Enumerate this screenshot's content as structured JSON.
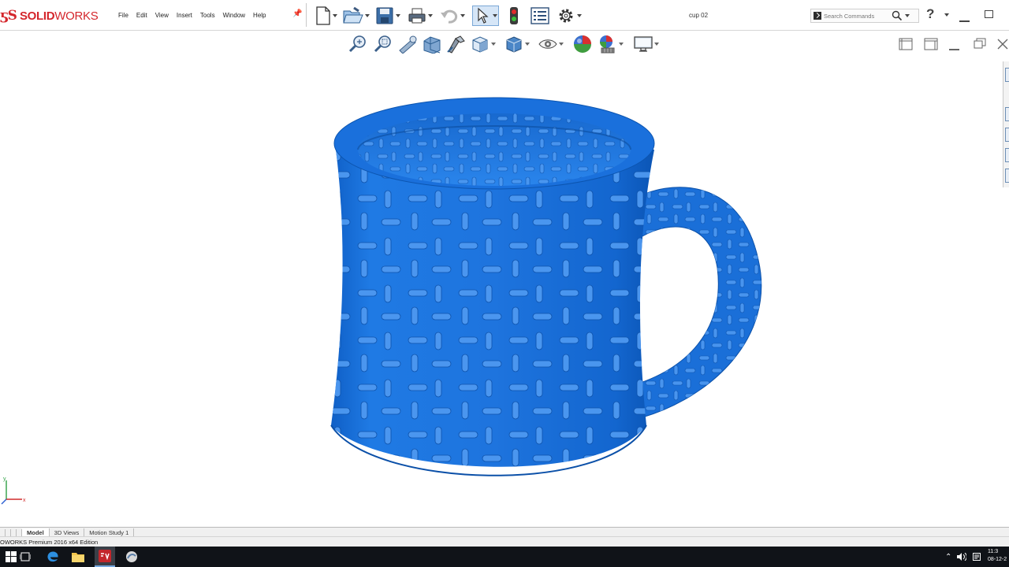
{
  "app": {
    "logo_mark": "ƽS",
    "logo_text_bold": "SOLID",
    "logo_text_light": "WORKS",
    "document_title": "cup 02",
    "brand_color": "#d4262c"
  },
  "menu": {
    "items": [
      "File",
      "Edit",
      "View",
      "Insert",
      "Tools",
      "Window",
      "Help"
    ]
  },
  "icons": {
    "main_toolbar": [
      "new-document-icon",
      "open-icon",
      "save-icon",
      "print-icon",
      "undo-icon",
      "select-icon",
      "rebuild-icon",
      "file-properties-icon",
      "options-icon"
    ],
    "view_toolbar": [
      "zoom-to-fit-icon",
      "zoom-to-area-icon",
      "previous-view-icon",
      "section-view-icon",
      "dynamic-annotation-icon",
      "view-orientation-icon",
      "display-style-icon",
      "hide-show-items-icon",
      "edit-appearance-icon",
      "apply-scene-icon",
      "view-settings-icon"
    ]
  },
  "search": {
    "placeholder": "Search Commands"
  },
  "model": {
    "name": "mug",
    "color": "#1e73d8"
  },
  "triad": {
    "x_label": "x",
    "y_label": "y"
  },
  "tabs": [
    "Model",
    "3D Views",
    "Motion Study 1"
  ],
  "active_tab": "Model",
  "status": {
    "edition": "OWORKS Premium 2016 x64 Edition"
  },
  "taskbar": {
    "time": "11:3",
    "date": "08-12-2"
  }
}
